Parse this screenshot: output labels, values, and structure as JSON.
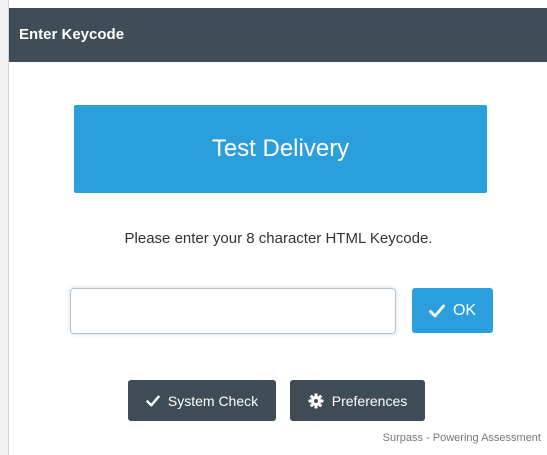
{
  "dialog": {
    "title": "Enter Keycode"
  },
  "banner": {
    "text": "Test Delivery"
  },
  "instructions": "Please enter your 8 character HTML Keycode.",
  "keycode": {
    "value": "",
    "placeholder": ""
  },
  "ok_button": {
    "label": "OK",
    "icon": "check-icon"
  },
  "system_check_button": {
    "label": "System Check",
    "icon": "check-icon"
  },
  "preferences_button": {
    "label": "Preferences",
    "icon": "gear-icon"
  },
  "footer": {
    "text": "Surpass - Powering Assessment"
  },
  "colors": {
    "titlebar": "#404d57",
    "accent": "#2a9fdc",
    "dark_button": "#3f4b55"
  }
}
